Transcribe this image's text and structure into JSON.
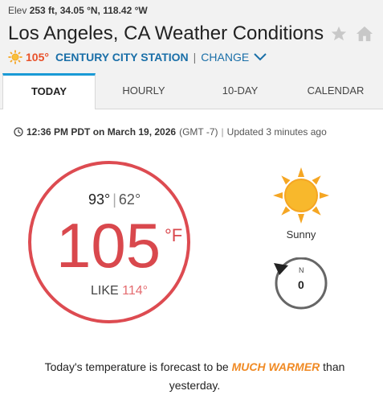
{
  "header": {
    "elev_label": "Elev",
    "elev_value": "253 ft,",
    "lat": "34.05 °N,",
    "lon": "118.42 °W",
    "title": "Los Angeles, CA Weather Conditions",
    "station_temp": "105°",
    "station_name": "CENTURY CITY STATION",
    "separator": "|",
    "change_label": "CHANGE"
  },
  "tabs": [
    {
      "label": "TODAY",
      "active": true
    },
    {
      "label": "HOURLY",
      "active": false
    },
    {
      "label": "10-DAY",
      "active": false
    },
    {
      "label": "CALENDAR",
      "active": false
    }
  ],
  "current": {
    "time": "12:36 PM PDT on March 19, 2026",
    "gmt": "(GMT -7)",
    "pipe": "|",
    "updated": "Updated 3 minutes ago",
    "high": "93°",
    "low": "62°",
    "hilo_sep": "|",
    "temp": "105",
    "unit": "°F",
    "feels_like_label": "LIKE",
    "feels_like_value": "114°",
    "condition": "Sunny",
    "wind_dir": "N",
    "wind_speed": "0"
  },
  "forecast": {
    "prefix": "Today's temperature is forecast to be",
    "highlight": "MUCH WARMER",
    "suffix": "than yesterday."
  },
  "colors": {
    "accent_blue": "#1a6fa8",
    "tab_indicator": "#1a9ad6",
    "temp_red": "#d9484d",
    "sun_orange": "#f5a623",
    "forecast_orange": "#f08a24"
  },
  "icons": [
    "sun-icon",
    "star-icon",
    "home-icon",
    "chevron-down-icon",
    "clock-icon",
    "wind-compass-icon"
  ]
}
